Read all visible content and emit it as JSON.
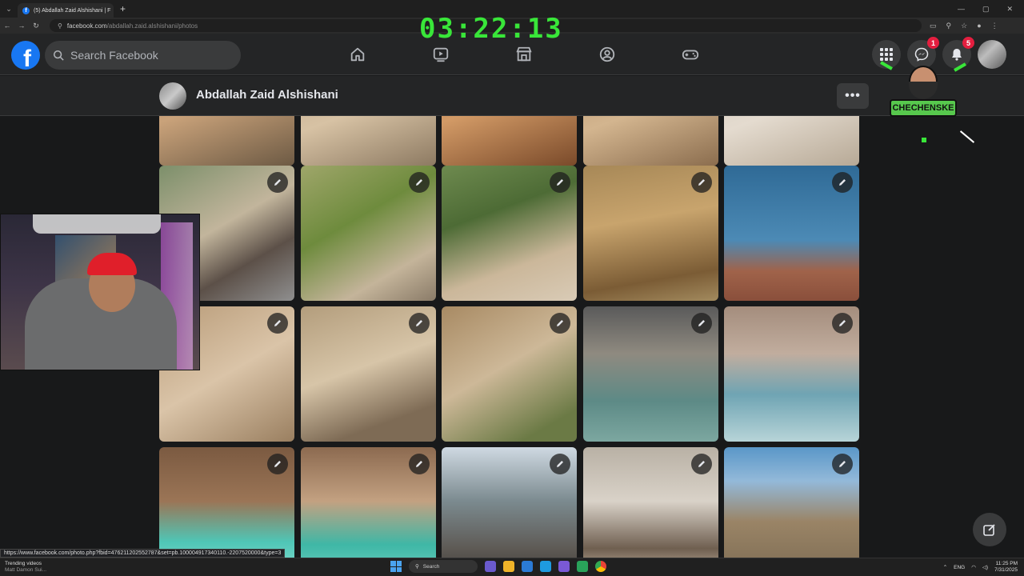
{
  "browser": {
    "tab_title": "(5) Abdallah Zaid Alshishani | F",
    "url_host": "facebook.com",
    "url_path": "/abdallah.zaid.alshishani/photos"
  },
  "overlay": {
    "timer": "03:22:13",
    "streamer_name": "CHECHENSKE"
  },
  "header": {
    "logo": "f",
    "search_placeholder": "Search Facebook",
    "nav": [
      "home-icon",
      "video-icon",
      "marketplace-icon",
      "groups-icon",
      "gaming-icon"
    ],
    "messenger_badge": "1",
    "notifications_badge": "5"
  },
  "profile": {
    "name": "Abdallah Zaid Alshishani",
    "more": "•••"
  },
  "photos": {
    "rows": [
      [
        {
          "grad": "linear-gradient(160deg,#9a7b58,#c9a27a 50%,#6d5a44)",
          "cut": true
        },
        {
          "grad": "linear-gradient(160deg,#b59c7f,#d7c2a4 55%,#8d7a62)",
          "cut": true
        },
        {
          "grad": "linear-gradient(160deg,#a7683b,#d29a66 50%,#7a4a2a)",
          "cut": true
        },
        {
          "grad": "linear-gradient(160deg,#b08a62,#d3b58f 55%,#8b6d4e)",
          "cut": true
        },
        {
          "grad": "linear-gradient(160deg,#cfc4b6,#e4dbcf 55%,#b7a996)",
          "cut": true
        }
      ],
      [
        {
          "grad": "linear-gradient(150deg,#7c8f6a,#c2b59c 45%,#5c5048 70%,#8f8f8f)"
        },
        {
          "grad": "linear-gradient(150deg,#9fa66a,#6e8b3d 40%,#c4b49a 75%,#8a7b68)"
        },
        {
          "grad": "linear-gradient(160deg,#6e8a4f,#4d6b35 35%,#cbb79a 70%,#d9cbb6)"
        },
        {
          "grad": "linear-gradient(170deg,#a78857,#c8a46d 40%,#7b5c35 80%,#a28a5e)"
        },
        {
          "grad": "linear-gradient(180deg,#2f6a96,#4c8ab5 55%,#a0634a 78%,#8a4f3b)"
        }
      ],
      [
        {
          "grad": "linear-gradient(150deg,#b89b78,#dac4a8 50%,#9a7f60)"
        },
        {
          "grad": "linear-gradient(160deg,#b39d7c,#d7c5a8 45%,#7e6b55 80%)"
        },
        {
          "grad": "linear-gradient(150deg,#a88a63,#cdb898 45%,#6b7a45 85%)"
        },
        {
          "grad": "linear-gradient(180deg,#5a5a5a,#8f8a80 35%,#5d8a86 70%,#7ca7a0)"
        },
        {
          "grad": "linear-gradient(180deg,#a48d7d,#c1ad9e 35%,#6fa4b3 65%,#b7d4d8)"
        }
      ],
      [
        {
          "grad": "linear-gradient(180deg,#7b5a41,#9b7556 40%,#4fc6b6 70%,#8ee0d4)"
        },
        {
          "grad": "linear-gradient(180deg,#8c6a50,#c3a181 40%,#3fb7a6 72%,#71d3c4)"
        },
        {
          "grad": "linear-gradient(180deg,#cfd9e2,#7b8a8f 40%,#5e5a55 75%,#3b3936)"
        },
        {
          "grad": "linear-gradient(180deg,#b9b1a5,#d9d2c8 40%,#6f5f50 75%,#d8c8b4)"
        },
        {
          "grad": "linear-gradient(180deg,#5a97c8,#93b9d9 25%,#9a8466 55%,#7a6a52)"
        }
      ]
    ]
  },
  "status_url": "https://www.facebook.com/photo.php?fbid=476211202552787&set=pb.100004917340110.-2207520000&type=3",
  "taskbar": {
    "weather_line1": "Trending videos",
    "weather_line2": "Matt Damon Sui...",
    "search": "Search",
    "lang": "ENG",
    "time": "11:25 PM",
    "date": "7/31/2025"
  }
}
